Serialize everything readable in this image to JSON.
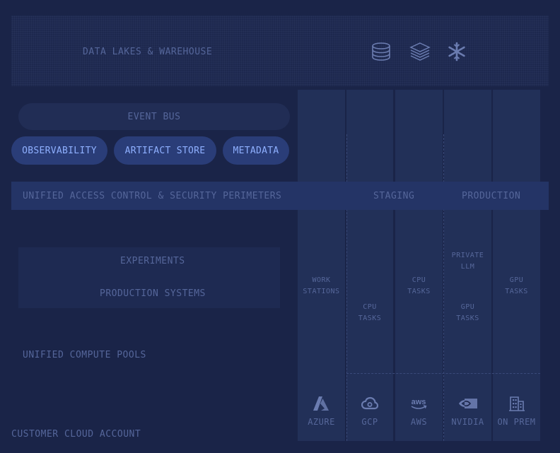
{
  "top": {
    "label": "DATA LAKES & WAREHOUSE",
    "icons": [
      "database-icon",
      "layers-stack-icon",
      "snowflake-icon"
    ]
  },
  "event_bus": "EVENT BUS",
  "pills": [
    "OBSERVABILITY",
    "ARTIFACT STORE",
    "METADATA"
  ],
  "band": {
    "label": "UNIFIED ACCESS CONTROL & SECURITY PERIMETERS",
    "staging": "STAGING",
    "production": "PRODUCTION"
  },
  "middle": {
    "experiments": "EXPERIMENTS",
    "production_systems": "PRODUCTION SYSTEMS"
  },
  "tasks": {
    "work_stations": [
      "WORK",
      "STATIONS"
    ],
    "cpu_tasks_gcp": [
      "CPU",
      "TASKS"
    ],
    "cpu_tasks_aws": [
      "CPU",
      "TASKS"
    ],
    "private_llm": [
      "PRIVATE",
      "LLM"
    ],
    "gpu_tasks_nvidia": [
      "GPU",
      "TASKS"
    ],
    "gpu_tasks_onprem": [
      "GPU",
      "TASKS"
    ]
  },
  "providers": [
    {
      "label": "AZURE",
      "icon": "azure-icon"
    },
    {
      "label": "GCP",
      "icon": "gcp-cloud-icon"
    },
    {
      "label": "AWS",
      "icon": "aws-icon"
    },
    {
      "label": "NVIDIA",
      "icon": "nvidia-icon"
    },
    {
      "label": "ON PREM",
      "icon": "building-icon"
    }
  ],
  "compute_pools": "UNIFIED COMPUTE POOLS",
  "customer_account": "CUSTOMER CLOUD ACCOUNT",
  "colors": {
    "background": "#1a2448",
    "pill_bg": "#2a3d78",
    "pill_text": "#8fb0ff",
    "muted_text": "#55669a"
  }
}
